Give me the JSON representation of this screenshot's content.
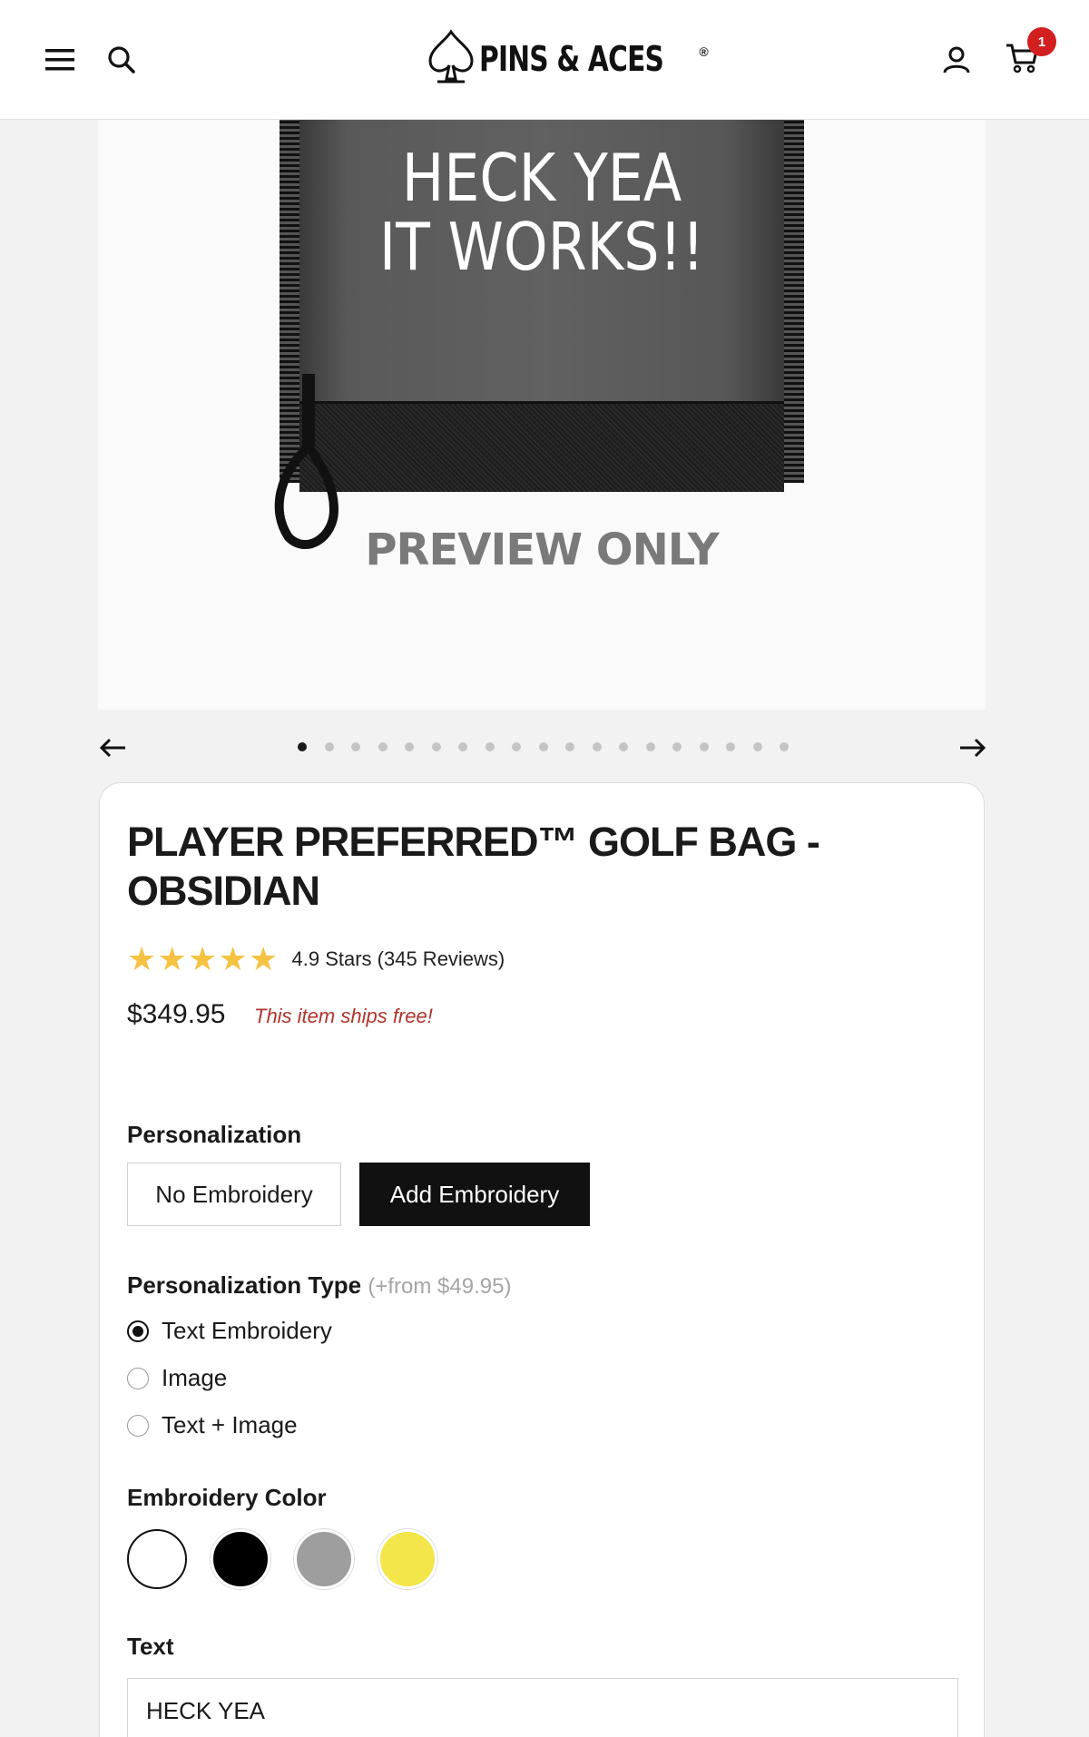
{
  "header": {
    "logo_text": "PINS & ACES",
    "cart_count": "1",
    "icons": [
      "menu-icon",
      "search-icon",
      "spade-logo-icon",
      "user-icon",
      "cart-icon"
    ]
  },
  "gallery": {
    "embroidery_line1": "HECK YEA",
    "embroidery_line2": "IT WORKS!!",
    "watermark": "PREVIEW ONLY",
    "slide_count": 19,
    "active_slide": 1
  },
  "product": {
    "title": "PLAYER PREFERRED™ GOLF BAG - OBSIDIAN",
    "rating_value": 4.9,
    "rating_text": "4.9 Stars (345 Reviews)",
    "price": "$349.95",
    "shipping_note": "This item ships free!"
  },
  "personalization": {
    "label": "Personalization",
    "options": [
      "No Embroidery",
      "Add Embroidery"
    ],
    "selected": "Add Embroidery"
  },
  "personalization_type": {
    "label": "Personalization Type",
    "price_note": "(+from $49.95)",
    "options": [
      "Text Embroidery",
      "Image",
      "Text + Image"
    ],
    "selected": "Text Embroidery"
  },
  "embroidery_color": {
    "label": "Embroidery Color",
    "colors": [
      "#ffffff",
      "#000000",
      "#9e9e9e",
      "#f2e64a"
    ],
    "selected": "#ffffff"
  },
  "text_field": {
    "label": "Text",
    "value": "HECK YEA"
  },
  "colors": {
    "accent_red": "#b0342a",
    "badge_red": "#d21f1f",
    "star_yellow": "#f6c242"
  }
}
